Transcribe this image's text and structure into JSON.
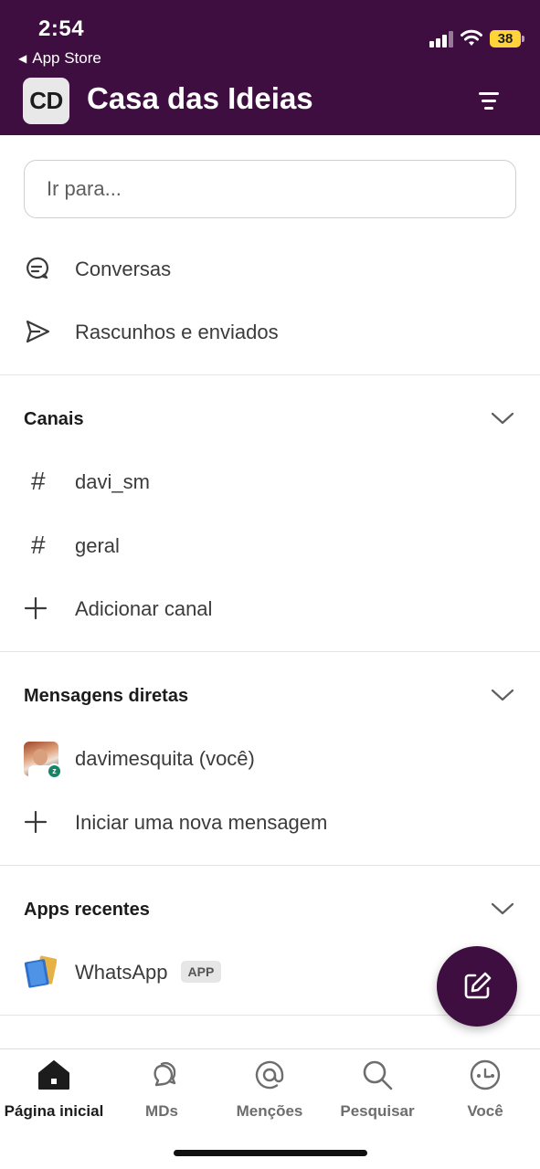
{
  "status_bar": {
    "time": "2:54",
    "back_app": "App Store",
    "battery": "38",
    "back_icon": "triangle-left-icon",
    "signal_icon": "cellular-signal-icon",
    "wifi_icon": "wifi-icon"
  },
  "header": {
    "workspace_initials": "CD",
    "workspace_name": "Casa das Ideias",
    "filter_icon": "filter-icon",
    "bg_color": "#3f0e40"
  },
  "search": {
    "placeholder": "Ir para..."
  },
  "quick_links": [
    {
      "label": "Conversas",
      "icon": "threads-icon"
    },
    {
      "label": "Rascunhos e enviados",
      "icon": "send-icon"
    }
  ],
  "channels": {
    "title": "Canais",
    "items": [
      {
        "label": "davi_sm",
        "icon": "hash-icon",
        "glyph": "#"
      },
      {
        "label": "geral",
        "icon": "hash-icon",
        "glyph": "#"
      }
    ],
    "add_label": "Adicionar canal"
  },
  "direct_messages": {
    "title": "Mensagens diretas",
    "items": [
      {
        "label": "davimesquita (você)",
        "presence": "z"
      }
    ],
    "new_label": "Iniciar uma nova mensagem"
  },
  "recent_apps": {
    "title": "Apps recentes",
    "items": [
      {
        "label": "WhatsApp",
        "badge": "APP",
        "icon": "notebook-icon"
      }
    ]
  },
  "fab": {
    "icon": "compose-icon"
  },
  "tabbar": {
    "tabs": [
      {
        "label": "Página inicial",
        "icon": "home-icon",
        "active": true
      },
      {
        "label": "MDs",
        "icon": "messages-icon",
        "active": false
      },
      {
        "label": "Menções",
        "icon": "at-icon",
        "active": false
      },
      {
        "label": "Pesquisar",
        "icon": "search-icon",
        "active": false
      },
      {
        "label": "Você",
        "icon": "profile-icon",
        "active": false
      }
    ]
  }
}
